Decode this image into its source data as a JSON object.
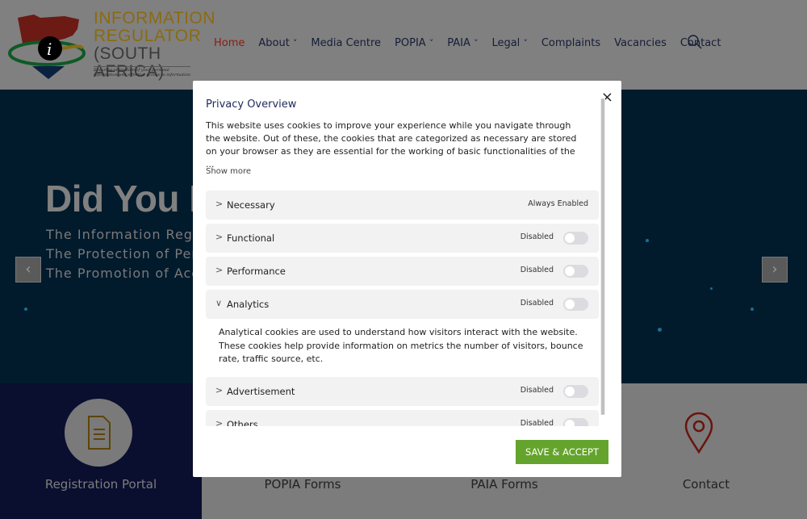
{
  "header": {
    "logo": {
      "line1": "INFORMATION",
      "line2": "REGULATOR",
      "line3": "(SOUTH AFRICA)",
      "tagline": "Ensuring protection of your personal information and effective access to information"
    },
    "nav": [
      {
        "label": "Home",
        "active": true
      },
      {
        "label": "About",
        "dropdown": true
      },
      {
        "label": "Media Centre"
      },
      {
        "label": "POPIA",
        "dropdown": true
      },
      {
        "label": "PAIA",
        "dropdown": true
      },
      {
        "label": "Legal",
        "dropdown": true
      },
      {
        "label": "Complaints"
      },
      {
        "label": "Vacancies"
      },
      {
        "label": "Contact"
      }
    ],
    "search_icon": "search-icon"
  },
  "hero": {
    "title": "Did You K",
    "lines": [
      "The Information Regul",
      "The Protection of Pers",
      "The Promotion of Acce"
    ],
    "prev": "‹",
    "next": "›"
  },
  "cards": [
    {
      "title": "Registration Portal",
      "icon": "document-icon"
    },
    {
      "title": "POPIA Forms"
    },
    {
      "title": "PAIA Forms"
    },
    {
      "title": "Contact",
      "icon": "map-pin-icon"
    }
  ],
  "modal": {
    "title": "Privacy Overview",
    "description": "This website uses cookies to improve your experience while you navigate through the website. Out of these, the cookies that are categorized as necessary are stored on your browser as they are essential for the working of basic functionalities of the ...",
    "show_more": "Show more",
    "close": "×",
    "categories": [
      {
        "name": "Necessary",
        "status": "Always Enabled",
        "chevron": ">"
      },
      {
        "name": "Functional",
        "status": "Disabled",
        "enabled": false,
        "chevron": ">"
      },
      {
        "name": "Performance",
        "status": "Disabled",
        "enabled": false,
        "chevron": ">"
      },
      {
        "name": "Analytics",
        "status": "Disabled",
        "enabled": false,
        "expanded": true,
        "chevron": "∨",
        "description": "Analytical cookies are used to understand how visitors interact with the website. These cookies help provide information on metrics the number of visitors, bounce rate, traffic source, etc."
      },
      {
        "name": "Advertisement",
        "status": "Disabled",
        "enabled": false,
        "chevron": ">"
      },
      {
        "name": "Others",
        "status": "Disabled",
        "enabled": false,
        "chevron": ">"
      }
    ],
    "save_label": "SAVE & ACCEPT",
    "colors": {
      "accent": "#64a42c",
      "title": "#1e2a5a"
    }
  }
}
